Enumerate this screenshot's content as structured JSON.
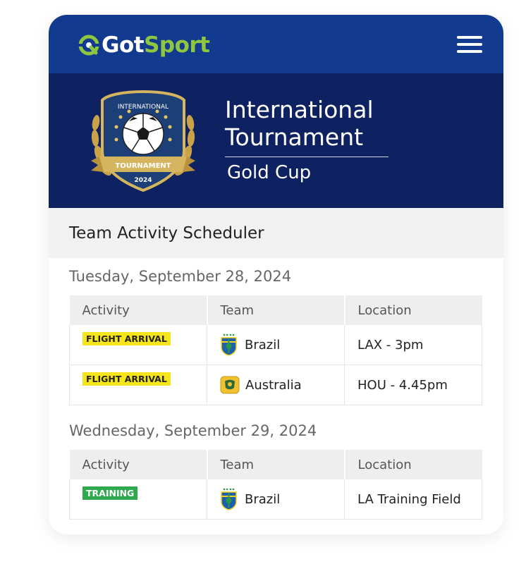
{
  "header": {
    "logo_got": "Got",
    "logo_sport": "Sport",
    "menu_icon": "hamburger-menu-icon"
  },
  "tournament": {
    "title": "International Tournament",
    "subtitle": "Gold Cup",
    "badge_top": "INTERNATIONAL",
    "badge_ribbon": "TOURNAMENT",
    "badge_year": "2024"
  },
  "scheduler": {
    "heading": "Team Activity Scheduler",
    "columns": [
      "Activity",
      "Team",
      "Location"
    ],
    "days": [
      {
        "date": "Tuesday, September 28, 2024",
        "rows": [
          {
            "activity": "FLIGHT ARRIVAL",
            "team": "Brazil",
            "location": "LAX - 3pm"
          },
          {
            "activity": "FLIGHT ARRIVAL",
            "team": "Australia",
            "location": "HOU - 4.45pm"
          }
        ]
      },
      {
        "date": "Wednesday, September 29, 2024",
        "rows": [
          {
            "activity": "TRAINING",
            "team": "Brazil",
            "location": "LA Training Field"
          }
        ]
      }
    ]
  },
  "colors": {
    "topbar": "#123b8f",
    "hero": "#0e2160",
    "brand_green": "#8ec63f",
    "tag_flight": "#f7e51c",
    "tag_training": "#2fa94e"
  }
}
